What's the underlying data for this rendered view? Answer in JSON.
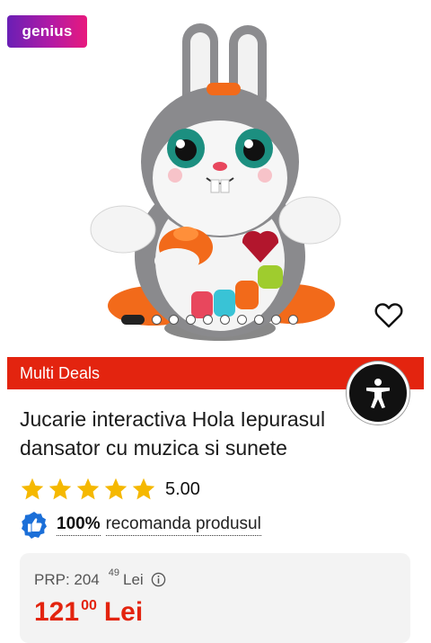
{
  "badge": {
    "label": "genius"
  },
  "carousel": {
    "total": 10,
    "active_index": 0
  },
  "deal_banner": {
    "label": "Multi Deals"
  },
  "product": {
    "title": "Jucarie interactiva Hola Iepurasul dansator cu muzica si sunete"
  },
  "rating": {
    "stars": 5,
    "value": "5.00"
  },
  "recommend": {
    "percent": "100%",
    "text": "recomanda produsul"
  },
  "price": {
    "prp_label": "PRP: 204",
    "prp_decimals": "49",
    "prp_currency": "Lei",
    "current_int": "121",
    "current_decimals": "00",
    "current_currency": "Lei"
  },
  "colors": {
    "brand_red": "#e3240f",
    "star_yellow": "#f5b800",
    "thumb_blue": "#1b6fd8",
    "genius_gradient_start": "#6a1fb5",
    "genius_gradient_end": "#e8197d"
  },
  "icons": {
    "favorite": "heart-outline-icon",
    "accessibility": "accessibility-person-icon",
    "recommend": "thumbs-up-icon",
    "info": "info-circle-icon"
  }
}
